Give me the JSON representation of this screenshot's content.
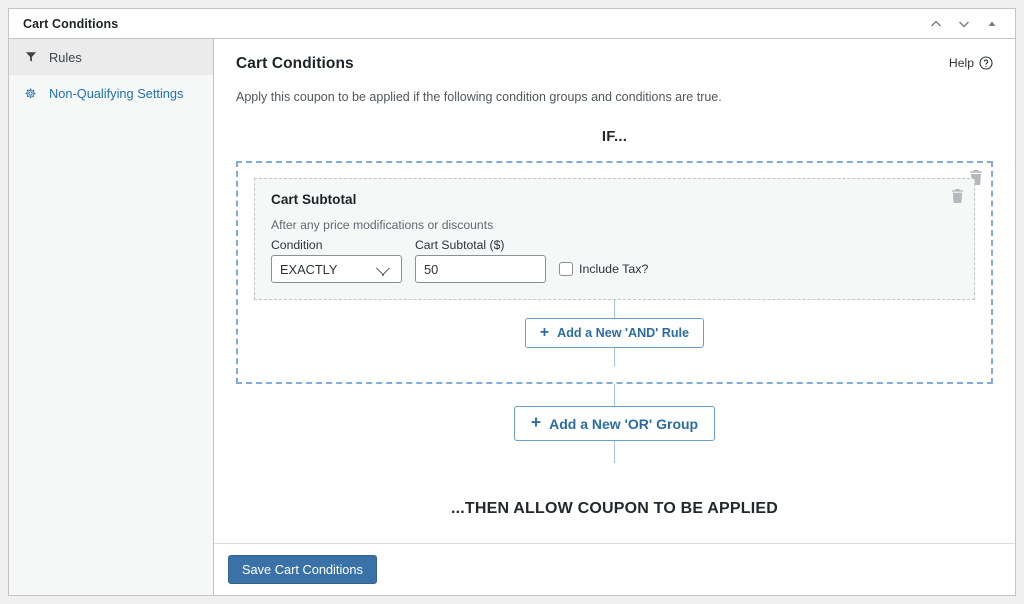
{
  "window": {
    "title": "Cart Conditions",
    "actions": [
      {
        "name": "move-up-icon",
        "label": "Move up"
      },
      {
        "name": "move-down-icon",
        "label": "Move down"
      },
      {
        "name": "collapse-icon",
        "label": "Toggle panel"
      }
    ]
  },
  "sidebar": {
    "items": [
      {
        "label": "Rules",
        "icon": "filter-icon",
        "active": true
      },
      {
        "label": "Non-Qualifying Settings",
        "icon": "gear-icon",
        "active": false
      }
    ]
  },
  "main": {
    "title": "Cart Conditions",
    "help_label": "Help",
    "subtitle": "Apply this coupon to be applied if the following condition groups and conditions are true.",
    "if_heading": "IF...",
    "then_heading": "...THEN ALLOW COUPON TO BE APPLIED"
  },
  "rule": {
    "title": "Cart Subtotal",
    "description": "After any price modifications or discounts",
    "condition_label": "Condition",
    "condition_value": "EXACTLY",
    "condition_options": [
      "EXACTLY"
    ],
    "amount_label": "Cart Subtotal ($)",
    "amount_value": "50",
    "include_tax_label": "Include Tax?",
    "include_tax_checked": false
  },
  "buttons": {
    "add_and_rule": "Add a New 'AND' Rule",
    "add_or_group": "Add a New 'OR' Group",
    "plus": "+",
    "save": "Save Cart Conditions"
  },
  "colors": {
    "accent_blue": "#2271b1",
    "button_blue": "#3a72a8",
    "group_dashed": "#7fadd8",
    "card_bg": "#f6f7f7"
  }
}
